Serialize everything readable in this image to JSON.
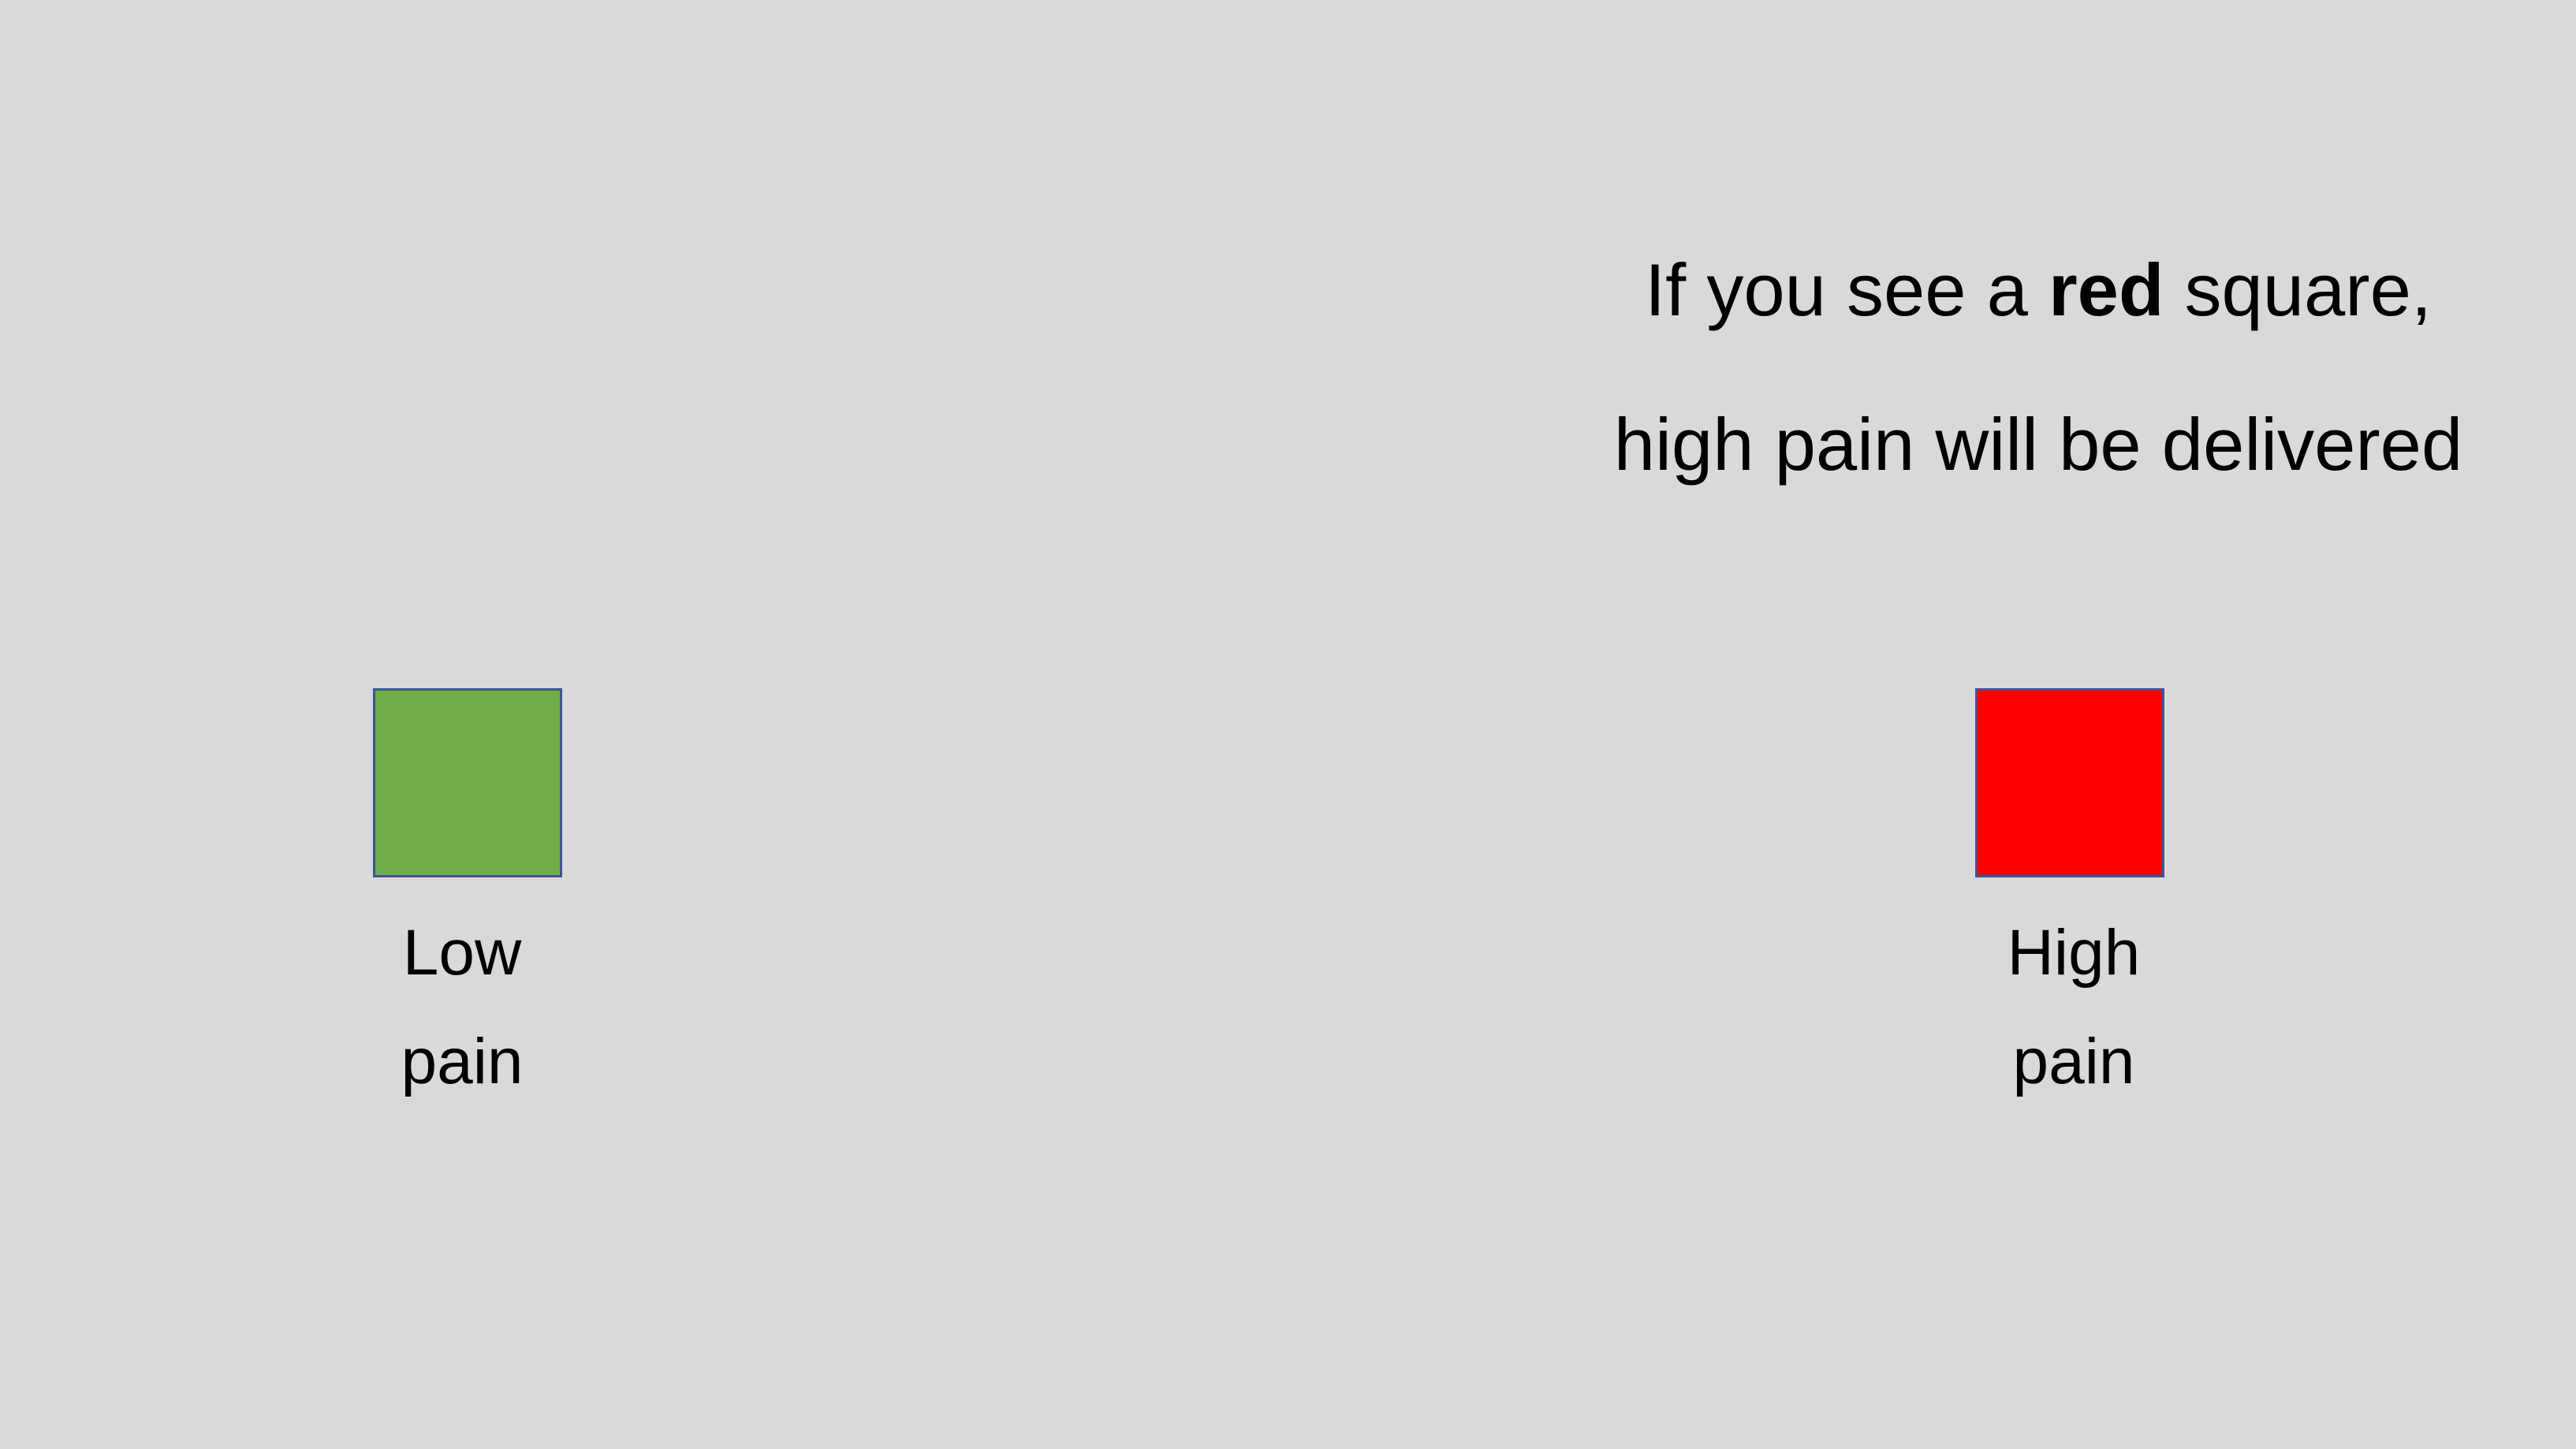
{
  "slide": {
    "background_color": "#d9d9d9",
    "instruction": {
      "line1_before": "If you see a ",
      "line1_bold": "red",
      "line1_after": " square,",
      "line2": "high pain will be delivered"
    },
    "squares": [
      {
        "color": "#70ad47",
        "border_color": "#3b5597",
        "label_line1": "Low",
        "label_line2": "pain"
      },
      {
        "color": "#ff0000",
        "border_color": "#3b5597",
        "label_line1": "High",
        "label_line2": "pain"
      }
    ]
  }
}
